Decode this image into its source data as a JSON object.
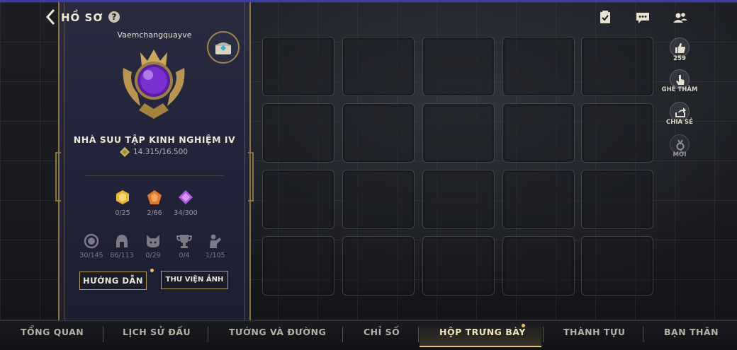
{
  "header": {
    "title": "HỒ SƠ",
    "help_label": "?"
  },
  "profile": {
    "username": "Vaemchangquayve",
    "rank_title": "NHÀ SUU TẬP KINH NGHIỆM IV",
    "experience": "14.315/16.500",
    "gems": [
      {
        "icon": "gold-gem-icon",
        "count": "0/25",
        "color": "#e8b838"
      },
      {
        "icon": "orange-gem-icon",
        "count": "2/66",
        "color": "#e07a2f"
      },
      {
        "icon": "purple-gem-icon",
        "count": "34/300",
        "color": "#b15de0"
      }
    ],
    "collections": [
      {
        "icon": "frame-icon",
        "count": "30/145"
      },
      {
        "icon": "helmet-icon",
        "count": "86/113"
      },
      {
        "icon": "pet-icon",
        "count": "0/29"
      },
      {
        "icon": "trophy-icon",
        "count": "0/4"
      },
      {
        "icon": "emote-icon",
        "count": "1/105"
      }
    ],
    "guide_button": "HƯỚNG DẪN",
    "gallery_button": "THƯ VIỆN ẢNH"
  },
  "side_actions": {
    "like_count": "259",
    "visit_label": "GHÉ THĂM",
    "share_label": "CHIA SẺ",
    "invite_label": "MỜI"
  },
  "tabs": [
    {
      "label": "TỔNG QUAN",
      "active": false
    },
    {
      "label": "LỊCH SỬ ĐẤU",
      "active": false
    },
    {
      "label": "TƯỚNG VÀ ĐƯỜNG",
      "active": false
    },
    {
      "label": "CHỈ SỐ",
      "active": false
    },
    {
      "label": "HỘP TRƯNG BÀY",
      "active": true
    },
    {
      "label": "THÀNH TỰU",
      "active": false
    },
    {
      "label": "BẠN THÂN",
      "active": false
    }
  ],
  "colors": {
    "accent_gold": "#b59d5e",
    "panel_bg": "#23243a",
    "active_tab": "#f1e3b5"
  }
}
